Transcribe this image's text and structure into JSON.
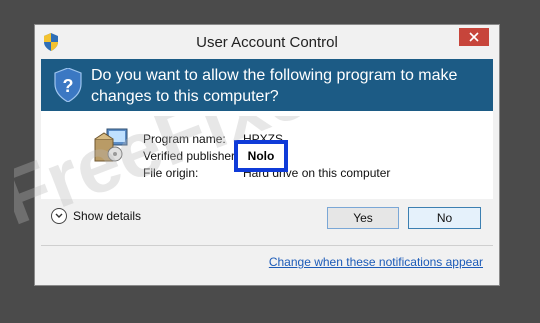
{
  "dialog": {
    "title": "User Account Control",
    "close_glyph": "✕",
    "question": "Do you want to allow the following program to make changes to this computer?",
    "fields": {
      "program_name_label": "Program name:",
      "program_name_value": "HPXZS",
      "verified_publisher_label": "Verified publisher:",
      "verified_publisher_value": "Nolo",
      "file_origin_label": "File origin:",
      "file_origin_value": "Hard drive on this computer"
    },
    "show_details_label": "Show details",
    "yes_label": "Yes",
    "no_label": "No",
    "notifications_link": "Change when these notifications appear"
  },
  "overlay": {
    "highlight_text": "Nolo",
    "watermark_text": "FreeFixer"
  },
  "colors": {
    "background": "#4b4b4b",
    "banner": "#1c5b85",
    "close": "#c7453b",
    "highlight_border": "#0f3bd8",
    "link": "#1c5bb8"
  },
  "icons": [
    "uac-shield-icon",
    "program-installer-icon",
    "chevron-down-icon",
    "close-icon"
  ]
}
